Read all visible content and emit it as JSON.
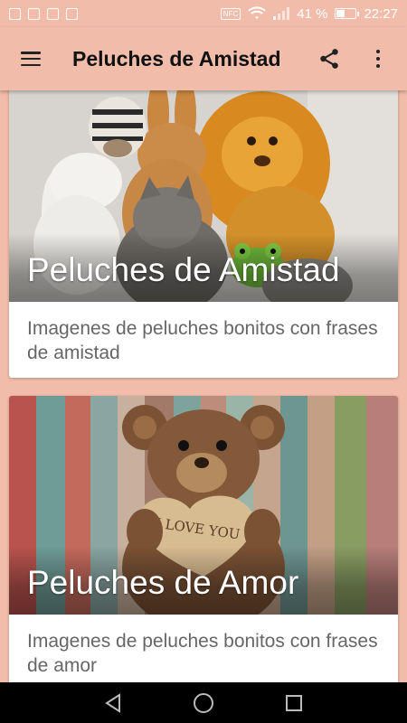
{
  "status_bar": {
    "nfc": "NFC",
    "battery_text": "41 %",
    "battery_level": 0.41,
    "time": "22:27",
    "icons": [
      "gallery-icon",
      "image-icon",
      "image-icon",
      "image-icon",
      "wifi-icon",
      "signal-icon",
      "battery-icon"
    ]
  },
  "app_bar": {
    "title": "Peluches de Amistad",
    "menu_icon": "hamburger-menu-icon",
    "share_icon": "share-icon",
    "overflow_icon": "more-vert-icon"
  },
  "cards": [
    {
      "title": "Peluches de Amistad",
      "description": "Imagenes de peluches bonitos con frases de amistad"
    },
    {
      "title": "Peluches de Amor",
      "description": "Imagenes de peluches bonitos con frases de amor",
      "image_text": "I LOVE YOU"
    }
  ],
  "nav_bar": {
    "back_icon": "back-triangle-icon",
    "home_icon": "home-circle-icon",
    "recents_icon": "recents-square-icon"
  },
  "colors": {
    "accent": "#f2bcaa",
    "text_dark": "#111111",
    "desc_text": "#666666"
  }
}
